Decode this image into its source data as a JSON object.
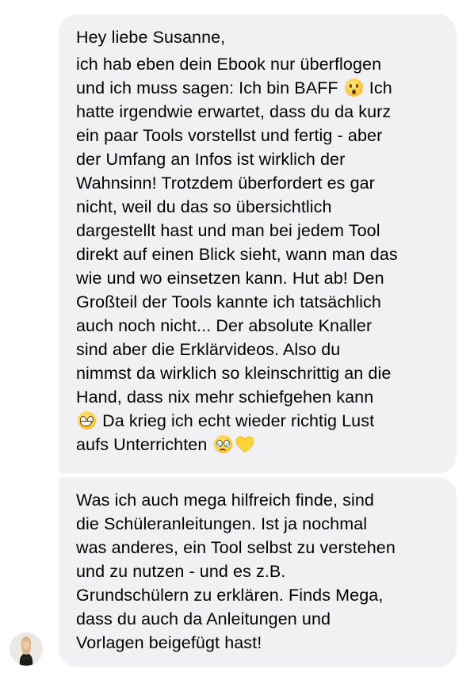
{
  "messages": [
    {
      "lines": [
        "Hey liebe Susanne,",
        "ich hab eben dein Ebook nur überflogen",
        "und ich muss sagen: Ich bin BAFF",
        "Ich",
        "hatte irgendwie erwartet, dass du da kurz",
        "ein paar Tools vorstellst und fertig - aber",
        "der Umfang an Infos ist wirklich der",
        "Wahnsinn! Trotzdem überfordert es gar",
        "nicht, weil du das so übersichtlich",
        "dargestellt hast und man bei jedem Tool",
        "direkt auf einen Blick sieht, wann man das",
        "wie und wo einsetzen kann. Hut ab! Den",
        "Großteil der Tools kannte ich tatsächlich",
        "auch noch nicht... Der absolute Knaller",
        "sind aber die Erklärvideos. Also du",
        "nimmst da wirklich so kleinschrittig an die",
        "Hand, dass nix mehr schiefgehen kann",
        "Da krieg ich echt wieder richtig Lust",
        "aufs Unterrichten"
      ],
      "emojis": [
        "hushed-face-emoji",
        "grinning-face-emoji",
        "pleading-face-emoji",
        "yellow-heart-emoji"
      ]
    },
    {
      "lines": [
        "Was ich auch mega hilfreich finde, sind",
        "die Schüleranleitungen. Ist ja nochmal",
        "was anderes, ein Tool selbst zu verstehen",
        "und zu nutzen - und es z.B.",
        "Grundschülern zu erklären. Finds Mega,",
        "dass du auch da Anleitungen und",
        "Vorlagen beigefügt hast!"
      ]
    }
  ],
  "colors": {
    "bubble_bg": "#f1f1f3",
    "text": "#000000",
    "background": "#ffffff",
    "heart": "#ffd43b"
  }
}
